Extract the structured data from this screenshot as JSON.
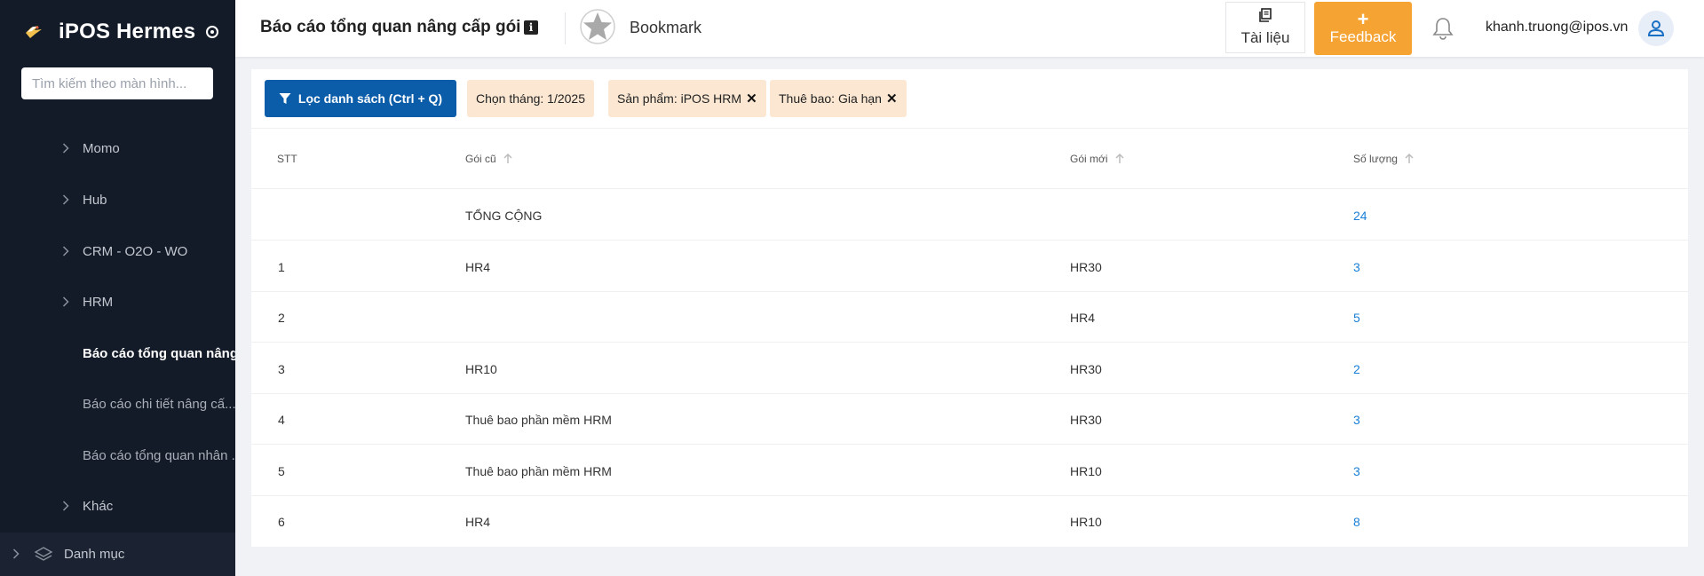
{
  "app": {
    "name": "iPOS Hermes"
  },
  "sidebar": {
    "search_placeholder": "Tìm kiếm theo màn hình...",
    "items": [
      {
        "label": "Momo",
        "type": "group"
      },
      {
        "label": "Hub",
        "type": "group"
      },
      {
        "label": "CRM - O2O - WO",
        "type": "group"
      },
      {
        "label": "HRM",
        "type": "group"
      },
      {
        "label": "Báo cáo tổng quan nâng ...",
        "type": "sub",
        "active": true
      },
      {
        "label": "Báo cáo chi tiết nâng cấ...",
        "type": "sub",
        "active": false
      },
      {
        "label": "Báo cáo tổng quan nhân ...",
        "type": "sub",
        "active": false
      },
      {
        "label": "Khác",
        "type": "group"
      }
    ],
    "bottom_item": {
      "label": "Danh mục"
    }
  },
  "header": {
    "title": "Báo cáo tổng quan nâng cấp gói",
    "bookmark_label": "Bookmark",
    "docs_label": "Tài liệu",
    "feedback_label": "Feedback",
    "user_email": "khanh.truong@ipos.vn"
  },
  "filters": {
    "filter_button": "Lọc danh sách (Ctrl + Q)",
    "chips": [
      {
        "label": "Chọn tháng: 1/2025",
        "removable": false
      },
      {
        "label": "Sản phẩm: iPOS HRM",
        "removable": true
      },
      {
        "label": "Thuê bao: Gia hạn",
        "removable": true
      }
    ]
  },
  "table": {
    "columns": [
      "STT",
      "Gói cũ",
      "Gói mới",
      "Số lượng"
    ],
    "total": {
      "label": "TỔNG CỘNG",
      "quantity": "24"
    },
    "rows": [
      {
        "stt": "1",
        "old": "HR4",
        "new": "HR30",
        "qty": "3"
      },
      {
        "stt": "2",
        "old": "",
        "new": "HR4",
        "qty": "5"
      },
      {
        "stt": "3",
        "old": "HR10",
        "new": "HR30",
        "qty": "2"
      },
      {
        "stt": "4",
        "old": "Thuê bao phần mềm HRM",
        "new": "HR30",
        "qty": "3"
      },
      {
        "stt": "5",
        "old": "Thuê bao phần mềm HRM",
        "new": "HR10",
        "qty": "3"
      },
      {
        "stt": "6",
        "old": "HR4",
        "new": "HR10",
        "qty": "8"
      }
    ]
  },
  "colors": {
    "sidebar_bg": "#141b28",
    "primary": "#0b5ca9",
    "feedback": "#f5a332",
    "chip_bg": "#fbe7d2",
    "link": "#1a7fd6"
  }
}
